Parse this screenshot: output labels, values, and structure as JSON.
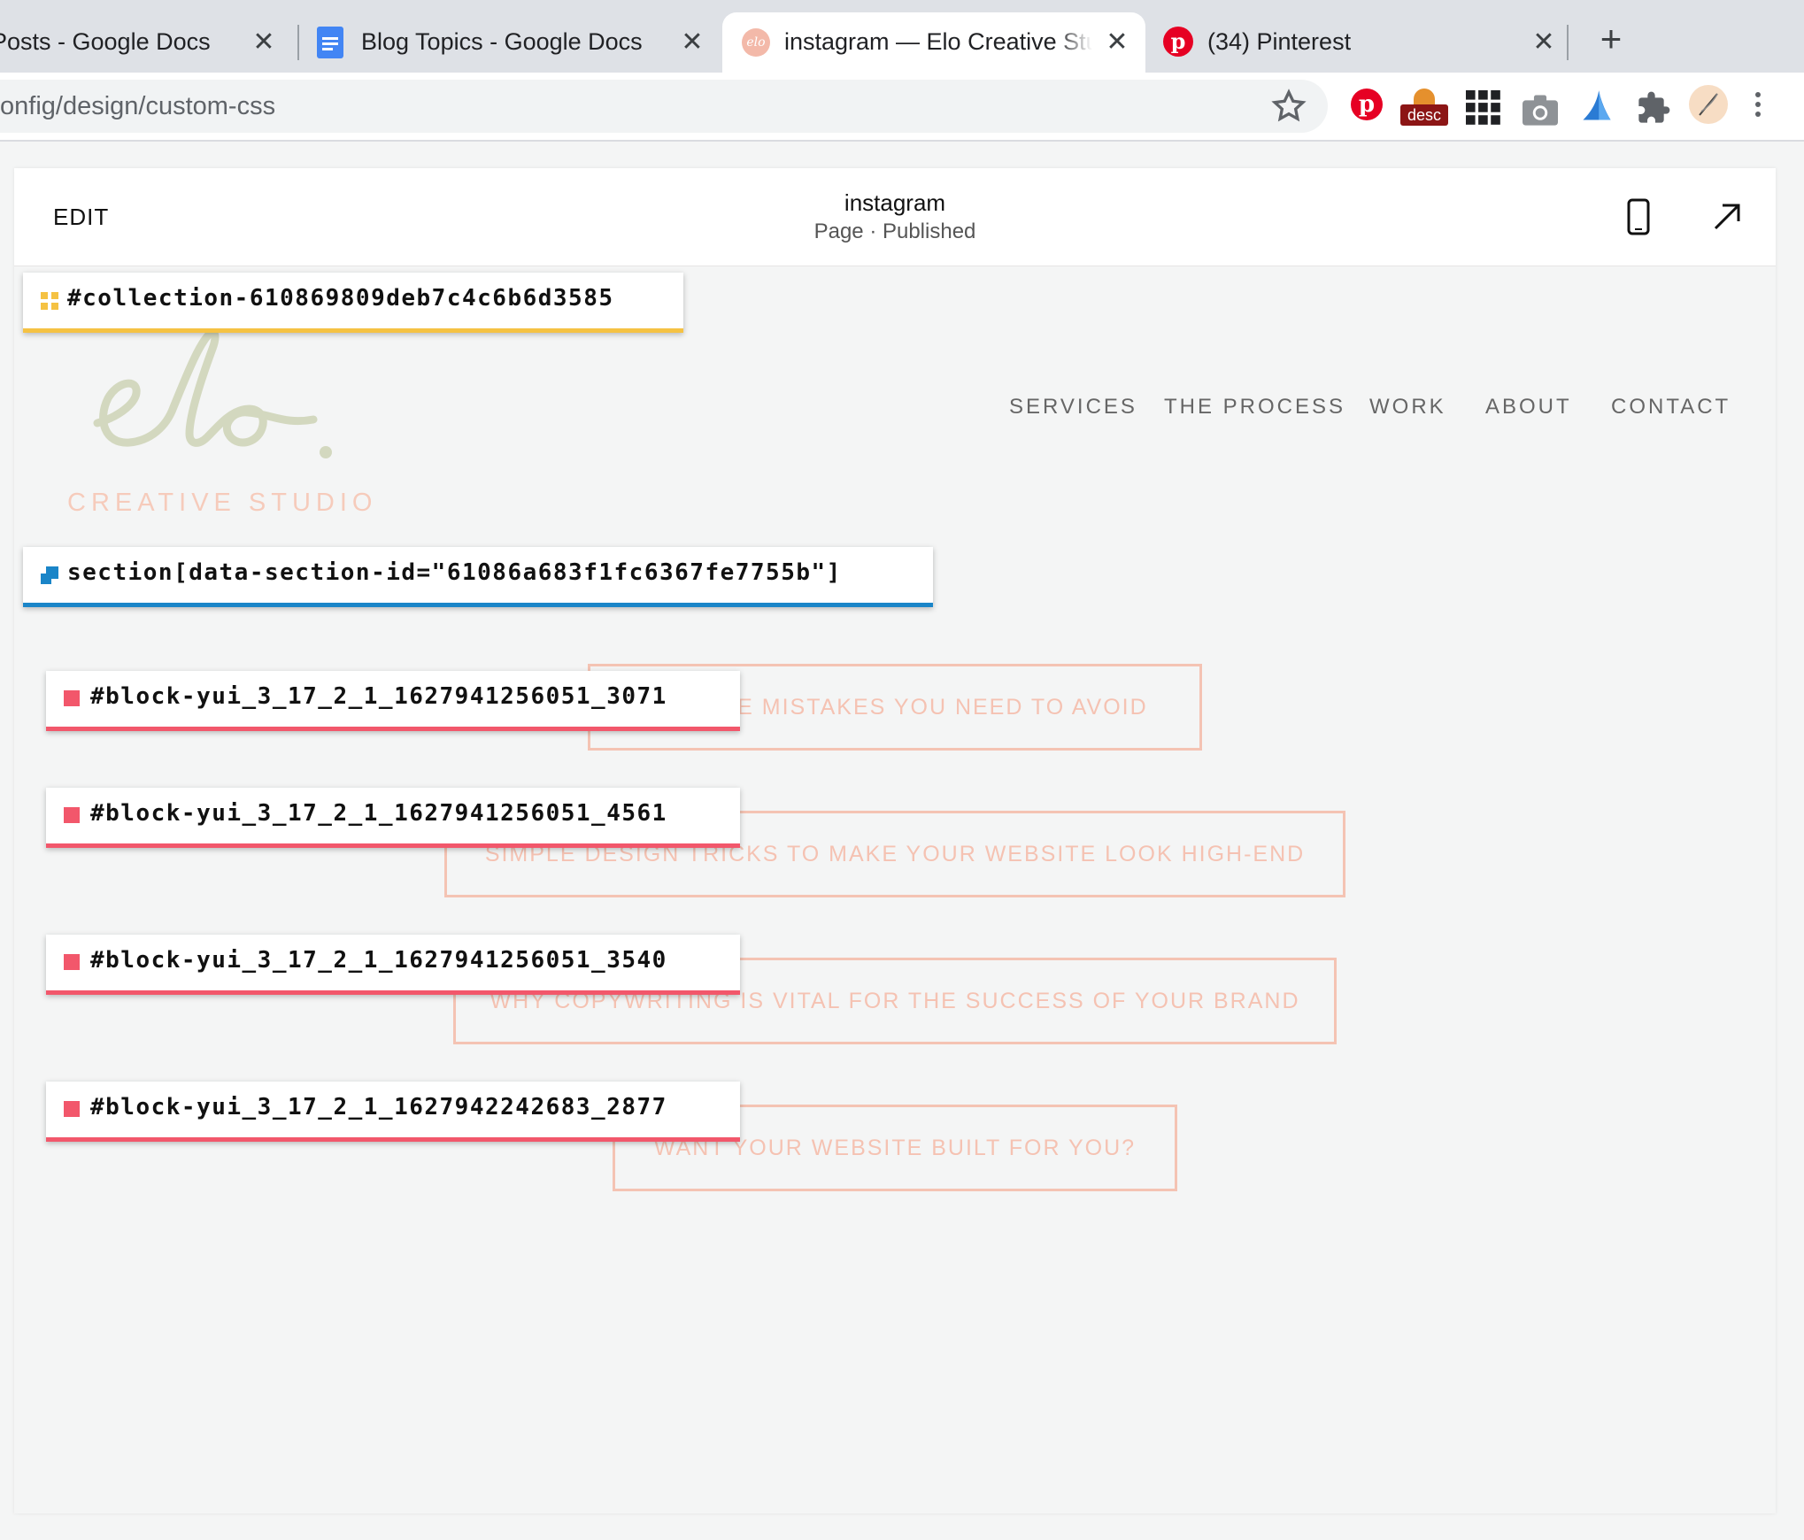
{
  "browser": {
    "tabs": [
      {
        "title": "Posts - Google Docs",
        "active": false
      },
      {
        "title": "Blog Topics - Google Docs",
        "active": false
      },
      {
        "title": "instagram — Elo Creative Studio",
        "active": true
      },
      {
        "title": "(34) Pinterest",
        "active": false
      }
    ],
    "close_glyph": "✕",
    "new_tab_glyph": "+",
    "url": "onfig/design/custom-css",
    "extension_badge": "desc"
  },
  "editor": {
    "edit_label": "EDIT",
    "page_title": "instagram",
    "page_status": "Page · Published"
  },
  "site": {
    "logo_script": "elo.",
    "tagline": "CREATIVE STUDIO",
    "nav": [
      "SERVICES",
      "THE PROCESS",
      "WORK",
      "ABOUT",
      "CONTACT"
    ],
    "buttons": [
      "WEBSITE MISTAKES YOU NEED TO AVOID",
      "SIMPLE DESIGN TRICKS TO MAKE YOUR WEBSITE LOOK HIGH-END",
      "WHY COPYWRITING IS VITAL FOR THE SUCCESS OF YOUR BRAND",
      "WANT YOUR WEBSITE BUILT FOR YOU?"
    ]
  },
  "selectors": [
    {
      "text": "#collection-610869809deb7c4c6b6d3585",
      "kind": "collection",
      "color": "#f5c243"
    },
    {
      "text": "section[data-section-id=\"61086a683f1fc6367fe7755b\"]",
      "kind": "section",
      "color": "#1a85c8"
    },
    {
      "text": "#block-yui_3_17_2_1_1627941256051_3071",
      "kind": "block",
      "color": "#f2576b"
    },
    {
      "text": "#block-yui_3_17_2_1_1627941256051_4561",
      "kind": "block",
      "color": "#f2576b"
    },
    {
      "text": "#block-yui_3_17_2_1_1627941256051_3540",
      "kind": "block",
      "color": "#f2576b"
    },
    {
      "text": "#block-yui_3_17_2_1_1627942242683_2877",
      "kind": "block",
      "color": "#f2576b"
    }
  ],
  "colors": {
    "logo_green": "#d3d8bf",
    "accent_pink": "#f4c3b3",
    "pinterest_red": "#e60023"
  }
}
